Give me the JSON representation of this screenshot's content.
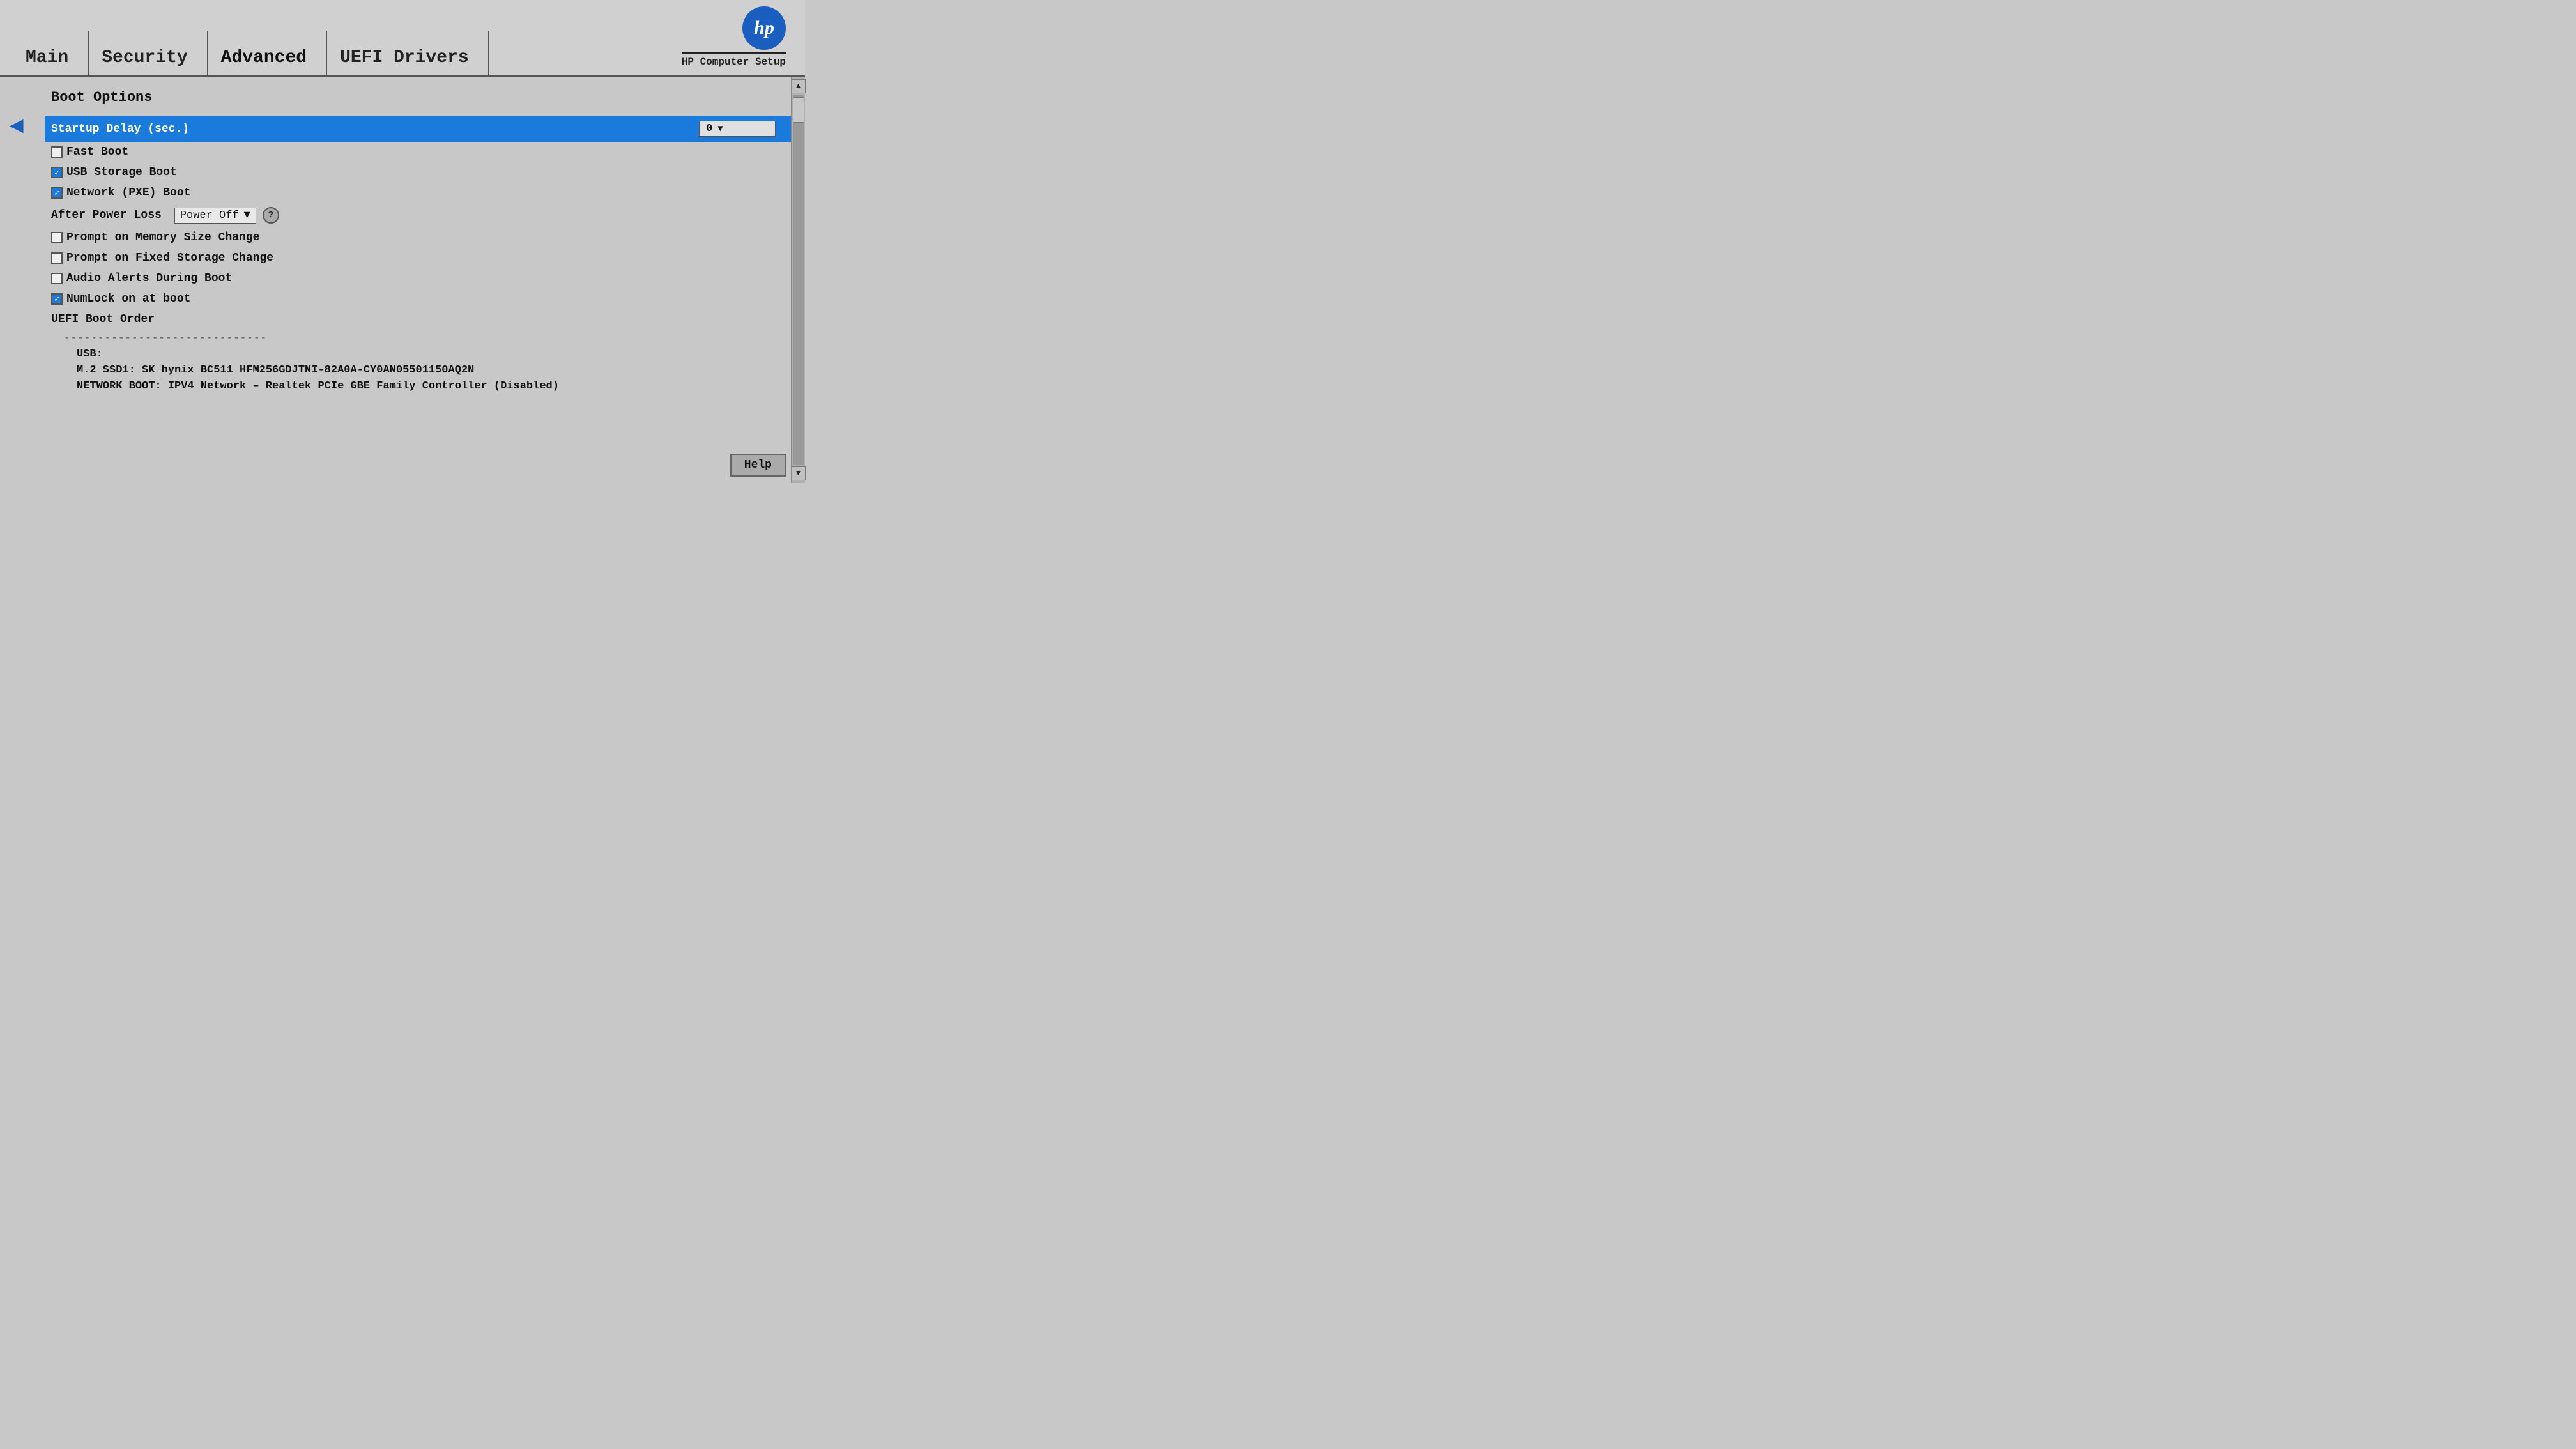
{
  "header": {
    "tabs": [
      {
        "id": "main",
        "label": "Main",
        "active": false
      },
      {
        "id": "security",
        "label": "Security",
        "active": false
      },
      {
        "id": "advanced",
        "label": "Advanced",
        "active": true
      },
      {
        "id": "uefi-drivers",
        "label": "UEFI Drivers",
        "active": false
      }
    ],
    "logo_text": "hp",
    "subtitle": "HP Computer Setup"
  },
  "page": {
    "section_title": "Boot Options",
    "back_arrow": "◀"
  },
  "settings": {
    "startup_delay_label": "Startup Delay (sec.)",
    "startup_delay_value": "0",
    "fast_boot_label": "Fast Boot",
    "fast_boot_checked": false,
    "usb_storage_boot_label": "USB Storage Boot",
    "usb_storage_boot_checked": true,
    "network_pxe_boot_label": "Network (PXE) Boot",
    "network_pxe_boot_checked": true,
    "after_power_loss_label": "After Power Loss",
    "after_power_loss_value": "Power Off",
    "prompt_memory_label": "Prompt on Memory Size Change",
    "prompt_memory_checked": false,
    "prompt_storage_label": "Prompt on Fixed Storage Change",
    "prompt_storage_checked": false,
    "audio_alerts_label": "Audio Alerts During Boot",
    "audio_alerts_checked": false,
    "numlock_label": "NumLock on at boot",
    "numlock_checked": true,
    "uefi_boot_order_label": "UEFI Boot Order",
    "divider": "------------------------------",
    "boot_item_usb": "USB:",
    "boot_item_ssd": "M.2 SSD1:  SK hynix BC511 HFM256GDJTNI-82A0A-CY0AN05501150AQ2N",
    "boot_item_network": "NETWORK BOOT:  IPV4 Network – Realtek PCIe GBE Family Controller (Disabled)"
  },
  "footer": {
    "help_btn_label": "Help"
  },
  "scrollbar": {
    "up_arrow": "▲",
    "down_arrow": "▼"
  }
}
